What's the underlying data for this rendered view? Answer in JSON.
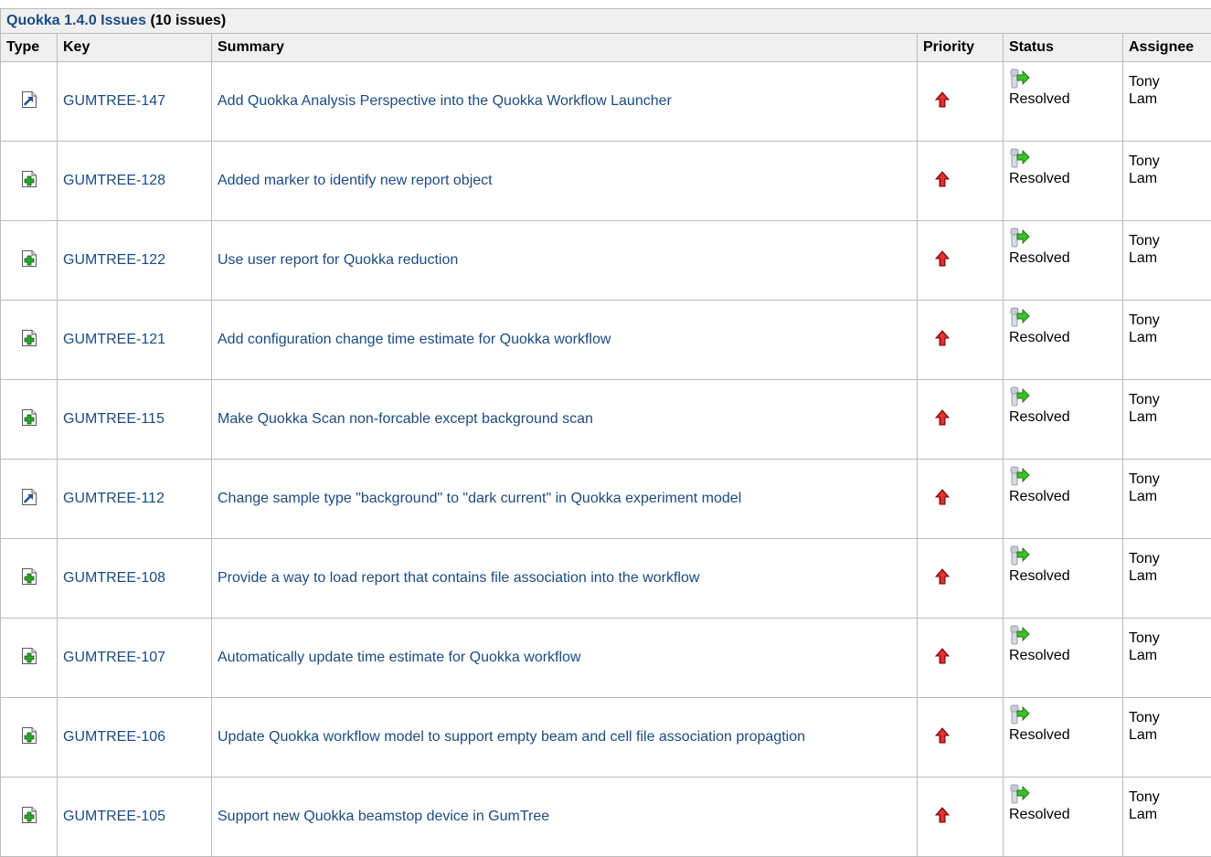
{
  "header": {
    "title_link": "Quokka 1.4.0 Issues",
    "title_count": "(10 issues)"
  },
  "columns": {
    "type": "Type",
    "key": "Key",
    "summary": "Summary",
    "priority": "Priority",
    "status": "Status",
    "assignee": "Assignee"
  },
  "issues": [
    {
      "type_icon": "improvement-icon",
      "key": "GUMTREE-147",
      "summary": "Add Quokka Analysis Perspective into the Quokka Workflow Launcher",
      "priority_icon": "priority-high-icon",
      "status_icon": "resolved-icon",
      "status": "Resolved",
      "assignee_first": "Tony",
      "assignee_last": "Lam"
    },
    {
      "type_icon": "new-feature-icon",
      "key": "GUMTREE-128",
      "summary": "Added marker to identify new report object",
      "priority_icon": "priority-high-icon",
      "status_icon": "resolved-icon",
      "status": "Resolved",
      "assignee_first": "Tony",
      "assignee_last": "Lam"
    },
    {
      "type_icon": "new-feature-icon",
      "key": "GUMTREE-122",
      "summary": "Use user report for Quokka reduction",
      "priority_icon": "priority-high-icon",
      "status_icon": "resolved-icon",
      "status": "Resolved",
      "assignee_first": "Tony",
      "assignee_last": "Lam"
    },
    {
      "type_icon": "new-feature-icon",
      "key": "GUMTREE-121",
      "summary": "Add configuration change time estimate for Quokka workflow",
      "priority_icon": "priority-high-icon",
      "status_icon": "resolved-icon",
      "status": "Resolved",
      "assignee_first": "Tony",
      "assignee_last": "Lam"
    },
    {
      "type_icon": "new-feature-icon",
      "key": "GUMTREE-115",
      "summary": "Make Quokka Scan non-forcable except background scan",
      "priority_icon": "priority-high-icon",
      "status_icon": "resolved-icon",
      "status": "Resolved",
      "assignee_first": "Tony",
      "assignee_last": "Lam"
    },
    {
      "type_icon": "improvement-icon",
      "key": "GUMTREE-112",
      "summary": "Change sample type \"background\" to \"dark current\" in Quokka experiment model",
      "priority_icon": "priority-high-icon",
      "status_icon": "resolved-icon",
      "status": "Resolved",
      "assignee_first": "Tony",
      "assignee_last": "Lam"
    },
    {
      "type_icon": "new-feature-icon",
      "key": "GUMTREE-108",
      "summary": "Provide a way to load report that contains file association into the workflow",
      "priority_icon": "priority-high-icon",
      "status_icon": "resolved-icon",
      "status": "Resolved",
      "assignee_first": "Tony",
      "assignee_last": "Lam"
    },
    {
      "type_icon": "new-feature-icon",
      "key": "GUMTREE-107",
      "summary": "Automatically update time estimate for Quokka workflow",
      "priority_icon": "priority-high-icon",
      "status_icon": "resolved-icon",
      "status": "Resolved",
      "assignee_first": "Tony",
      "assignee_last": "Lam"
    },
    {
      "type_icon": "new-feature-icon",
      "key": "GUMTREE-106",
      "summary": "Update Quokka workflow model to support empty beam and cell file association propagtion",
      "priority_icon": "priority-high-icon",
      "status_icon": "resolved-icon",
      "status": "Resolved",
      "assignee_first": "Tony",
      "assignee_last": "Lam"
    },
    {
      "type_icon": "new-feature-icon",
      "key": "GUMTREE-105",
      "summary": "Support new Quokka beamstop device in GumTree",
      "priority_icon": "priority-high-icon",
      "status_icon": "resolved-icon",
      "status": "Resolved",
      "assignee_first": "Tony",
      "assignee_last": "Lam"
    }
  ]
}
